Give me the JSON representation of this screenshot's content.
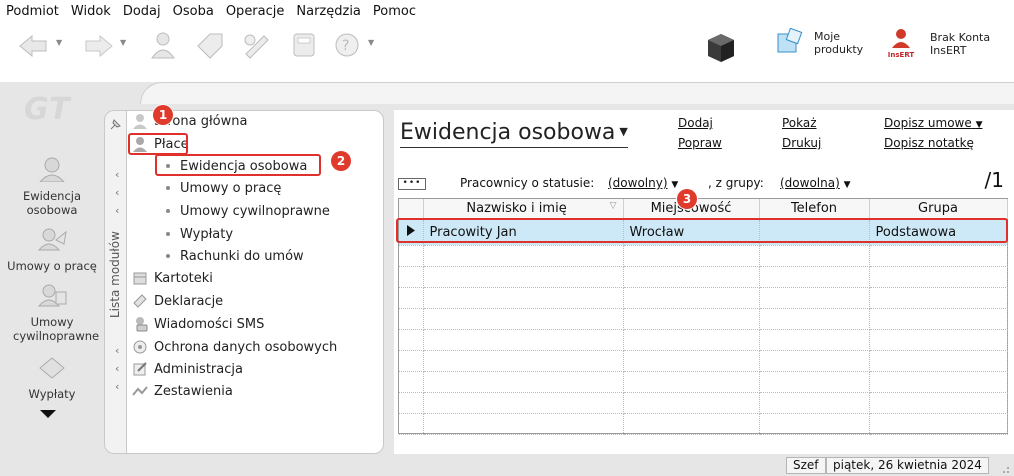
{
  "menu": [
    "Podmiot",
    "Widok",
    "Dodaj",
    "Osoba",
    "Operacje",
    "Narzędzia",
    "Pomoc"
  ],
  "toolbar": {
    "moje_produkty_l1": "Moje",
    "moje_produkty_l2": "produkty",
    "account_l1": "Brak Konta",
    "account_l2": "InsERT",
    "insert_logo": "InsERT"
  },
  "logo": "GT",
  "leftnav": [
    {
      "label": "Ewidencja osobowa",
      "icon": "ewidencja-icon"
    },
    {
      "label": "Umowy o pracę",
      "icon": "umowy-icon"
    },
    {
      "label": "Umowy cywilnoprawne",
      "icon": "cywilnoprawne-icon"
    },
    {
      "label": "Wypłaty",
      "icon": "wyplaty-icon"
    }
  ],
  "modules_strip_label": "Lista modułów",
  "tree": {
    "strona_glowna": "Strona główna",
    "place": "Płace",
    "place_children": [
      "Ewidencja osobowa",
      "Umowy o pracę",
      "Umowy cywilnoprawne",
      "Wypłaty",
      "Rachunki do umów"
    ],
    "others": [
      "Kartoteki",
      "Deklaracje",
      "Wiadomości SMS",
      "Ochrona danych osobowych",
      "Administracja",
      "Zestawienia"
    ]
  },
  "content": {
    "title": "Ewidencja osobowa",
    "actions": {
      "dodaj": "Dodaj",
      "popraw": "Popraw",
      "pokaz": "Pokaż",
      "drukuj": "Drukuj",
      "dopisz_umowe": "Dopisz umowe",
      "dopisz_notatke": "Dopisz notatkę"
    },
    "filter_label": "Pracownicy o statusie:",
    "filter_value": "(dowolny)",
    "group_label": ", z grupy:",
    "group_value": "(dowolna)",
    "dots": "•••",
    "count": "/1"
  },
  "grid": {
    "columns": [
      "Nazwisko i imię",
      "Miejscowość",
      "Telefon",
      "Grupa"
    ],
    "rows": [
      {
        "name": "Pracowity Jan",
        "city": "Wrocław",
        "phone": "",
        "group": "Podstawowa"
      }
    ]
  },
  "status": {
    "user": "Szef",
    "date": "piątek, 26 kwietnia 2024"
  },
  "annotations": [
    "1",
    "2",
    "3"
  ],
  "colors": {
    "annotation": "#e0302c",
    "selected_row": "#cde8f6"
  }
}
